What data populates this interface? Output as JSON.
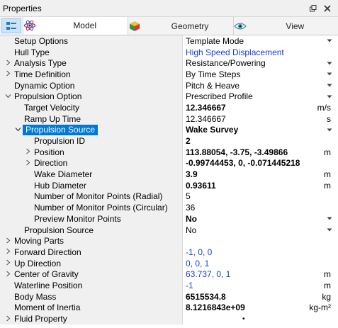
{
  "window": {
    "title": "Properties",
    "pin_icon": "pin-icon",
    "close_icon": "close-icon"
  },
  "tabs": [
    {
      "label": "Model",
      "icon": "atom-icon",
      "active": true
    },
    {
      "label": "Geometry",
      "icon": "cube-icon",
      "active": false
    },
    {
      "label": "View",
      "icon": "eye-icon",
      "active": false
    }
  ],
  "rows": [
    {
      "name": "Setup Options",
      "value": "Template Mode",
      "level": 0,
      "expander": "",
      "dropdown": true
    },
    {
      "name": "Hull Type",
      "value": "High Speed Displacement",
      "level": 0,
      "expander": "",
      "blue": true
    },
    {
      "name": "Analysis Type",
      "value": "Resistance/Powering",
      "level": 0,
      "expander": ">",
      "dropdown": true
    },
    {
      "name": "Time Definition",
      "value": "By Time Steps",
      "level": 0,
      "expander": ">",
      "dropdown": true
    },
    {
      "name": "Dynamic Option",
      "value": "Pitch & Heave",
      "level": 0,
      "expander": "",
      "dropdown": true
    },
    {
      "name": "Propulsion Option",
      "value": "Prescribed Profile",
      "level": 0,
      "expander": "v",
      "dropdown": true
    },
    {
      "name": "Target Velocity",
      "value": "12.346667",
      "level": 1,
      "expander": "",
      "bold": true,
      "unit": "m/s"
    },
    {
      "name": "Ramp Up Time",
      "value": "12.346667",
      "level": 1,
      "expander": "",
      "unit": "s"
    },
    {
      "name": "Propulsion Source",
      "value": "Wake Survey",
      "level": 1,
      "expander": "v",
      "selected": true,
      "bold": true,
      "dropdown": true
    },
    {
      "name": "Propulsion ID",
      "value": "2",
      "level": 2,
      "expander": "",
      "bold": true
    },
    {
      "name": "Position",
      "value": "113.88054, -3.75, -3.49866",
      "level": 2,
      "expander": ">",
      "bold": true,
      "unit": "m"
    },
    {
      "name": "Direction",
      "value": "-0.99744453, 0, -0.071445218",
      "level": 2,
      "expander": ">",
      "bold": true
    },
    {
      "name": "Wake Diameter",
      "value": "3.9",
      "level": 2,
      "expander": "",
      "bold": true,
      "unit": "m"
    },
    {
      "name": "Hub Diameter",
      "value": "0.93611",
      "level": 2,
      "expander": "",
      "bold": true,
      "unit": "m"
    },
    {
      "name": "Number of Monitor Points (Radial)",
      "value": "5",
      "level": 2,
      "expander": ""
    },
    {
      "name": "Number of Monitor Points (Circular)",
      "value": "36",
      "level": 2,
      "expander": ""
    },
    {
      "name": "Preview Monitor Points",
      "value": "No",
      "level": 2,
      "expander": "",
      "bold": true,
      "dropdown": true
    },
    {
      "name": "Propulsion Source",
      "value": "No",
      "level": 1,
      "expander": "",
      "dropdown": true
    },
    {
      "name": "Moving Parts",
      "value": "",
      "level": 0,
      "expander": ">"
    },
    {
      "name": "Forward Direction",
      "value": "-1, 0, 0",
      "level": 0,
      "expander": ">",
      "blue": true
    },
    {
      "name": "Up Direction",
      "value": "0, 0, 1",
      "level": 0,
      "expander": ">",
      "blue": true
    },
    {
      "name": "Center of Gravity",
      "value": "63.737, 0, 1",
      "level": 0,
      "expander": ">",
      "blue": true,
      "unit": "m"
    },
    {
      "name": "Waterline Position",
      "value": "-1",
      "level": 0,
      "expander": "",
      "blue": true,
      "unit": "m"
    },
    {
      "name": "Body Mass",
      "value": "6515534.8",
      "level": 0,
      "expander": "",
      "bold": true,
      "unit": "kg"
    },
    {
      "name": "Moment of Inertia",
      "value": "8.1216843e+09",
      "level": 0,
      "expander": "",
      "bold": true,
      "unit": "kg-m²"
    },
    {
      "name": "Fluid Property",
      "value": "",
      "level": 0,
      "expander": ">",
      "dot": "•"
    }
  ]
}
